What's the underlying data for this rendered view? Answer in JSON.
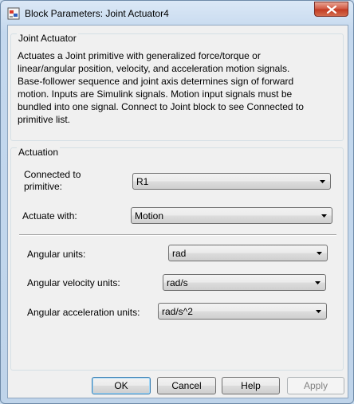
{
  "window": {
    "title": "Block Parameters: Joint Actuator4",
    "title_color": "#000000",
    "frame_color": "#c4d8ee"
  },
  "block_group": {
    "title": "Joint Actuator",
    "description": "Actuates a Joint primitive with generalized force/torque or\nlinear/angular position, velocity, and acceleration motion signals.\nBase-follower sequence and joint axis determines sign of forward\nmotion. Inputs are Simulink signals. Motion input signals must be\nbundled into one signal. Connect to Joint block to see Connected to\nprimitive list."
  },
  "actuation": {
    "title": "Actuation",
    "connected_label": "Connected to\nprimitive:",
    "connected_value": "R1",
    "actuate_label": "Actuate with:",
    "actuate_value": "Motion",
    "angular_units_label": "Angular units:",
    "angular_units_value": "rad",
    "angular_velocity_label": "Angular velocity units:",
    "angular_velocity_value": "rad/s",
    "angular_accel_label": "Angular acceleration units:",
    "angular_accel_value": "rad/s^2"
  },
  "buttons": {
    "ok": "OK",
    "cancel": "Cancel",
    "help": "Help",
    "apply": "Apply"
  },
  "icons": {
    "app": "simulink-block-icon",
    "close": "close-icon",
    "dropdown": "chevron-down-icon"
  }
}
